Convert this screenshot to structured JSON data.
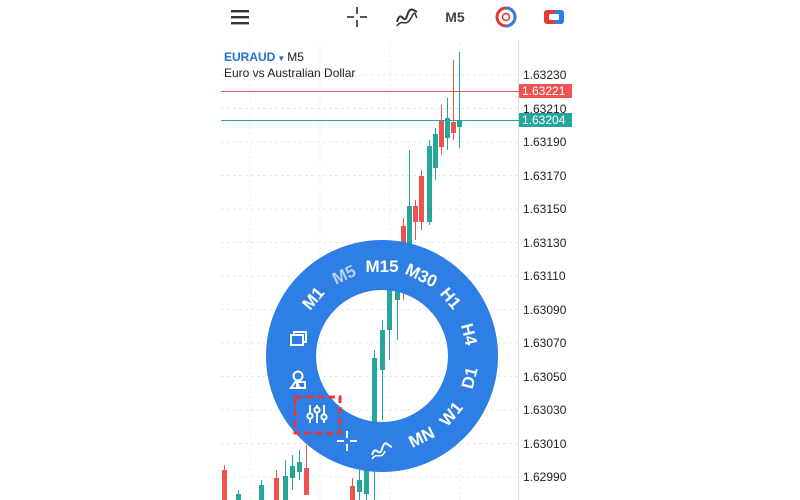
{
  "toolbar": {
    "menu_icon": "hamburger-menu-icon",
    "crosshair_icon": "crosshair-icon",
    "indicators_icon": "indicator-wave-icon",
    "timeframe_label": "M5",
    "trade_icon": "trade-circle-icon",
    "quick_trade_icon": "quick-trade-icon"
  },
  "symbol": {
    "name": "EURAUD",
    "timeframe": "M5",
    "description": "Euro vs Australian Dollar"
  },
  "price_axis": {
    "labels": [
      "1.63230",
      "1.63210",
      "1.63190",
      "1.63170",
      "1.63150",
      "1.63130",
      "1.63110",
      "1.63090",
      "1.63070",
      "1.63050",
      "1.63030",
      "1.63010",
      "1.62990"
    ]
  },
  "price_tags": {
    "ask": "1.63221",
    "bid": "1.63204"
  },
  "colors": {
    "bullish": "#26a69a",
    "bearish": "#ef5350",
    "ring": "#2d7fe6",
    "ask_line": "#ef5350",
    "bid_line": "#26a69a",
    "highlight": "#e53935"
  },
  "ring_menu": {
    "timeframes": [
      "M1",
      "M5",
      "M15",
      "M30",
      "H1",
      "H4",
      "D1",
      "W1",
      "MN"
    ],
    "selected": "M5",
    "tools": [
      {
        "name": "windows-icon"
      },
      {
        "name": "objects-icon"
      },
      {
        "name": "settings-sliders-icon"
      },
      {
        "name": "crosshair-icon"
      },
      {
        "name": "indicator-wave-icon"
      }
    ]
  }
}
